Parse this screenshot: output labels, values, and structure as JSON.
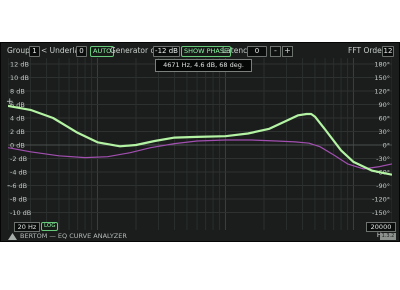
{
  "toolbar": {
    "group_label": "Group",
    "group_value": "1",
    "underlay_label": "< Underlay",
    "underlay_value": "0",
    "auto_label": "AUTO",
    "generator_label": "Generator out",
    "generator_value": "-12 dB",
    "show_phase_label": "SHOW PHASE",
    "latency_label": "Latency",
    "latency_value": "0",
    "minus_label": "-",
    "plus_label": "+",
    "fft_label": "FFT Order",
    "fft_value": "12"
  },
  "tooltip": "4671 Hz, 4.6 dB, 68 deg.",
  "side_markers": {
    "plus": "+",
    "minus": "-"
  },
  "freq": {
    "min": "20 Hz",
    "log_label": "LOG",
    "max": "20000 Hz"
  },
  "footer": {
    "title": "BERTOM — EQ CURVE ANALYZER",
    "version": "1.3.2"
  },
  "colors": {
    "eq_curve": "#b3f3a3",
    "phase_curve": "#a24fb1",
    "background": "#1a1d1c",
    "accent": "#67c97a"
  },
  "chart_data": {
    "type": "line",
    "x_scale": "log",
    "xlim": [
      20,
      20000
    ],
    "y_left_ticks": [
      "12 dB",
      "10 dB",
      "8 dB",
      "6 dB",
      "4 dB",
      "2 dB",
      "0 dB",
      "-2 dB",
      "-4 dB",
      "-6 dB",
      "-8 dB",
      "-10 dB"
    ],
    "y_right_ticks": [
      "180°",
      "150°",
      "120°",
      "90°",
      "60°",
      "30°",
      "0°",
      "-30°",
      "-60°",
      "-90°",
      "-120°",
      "-150°"
    ],
    "ylim_db": [
      -12,
      12
    ],
    "ylim_deg": [
      -180,
      180
    ],
    "series": [
      {
        "color": "#b3f3a3",
        "unit": "dB",
        "x": [
          20,
          30,
          45,
          70,
          100,
          150,
          200,
          280,
          400,
          600,
          1000,
          1500,
          2200,
          3000,
          3700,
          4300,
          4671,
          5000,
          6000,
          8000,
          10000,
          14000,
          20000
        ],
        "y": [
          5.8,
          5.2,
          4.0,
          1.8,
          0.4,
          -0.2,
          0.0,
          0.6,
          1.1,
          1.2,
          1.3,
          1.7,
          2.4,
          3.6,
          4.4,
          4.6,
          4.6,
          4.2,
          2.3,
          -0.8,
          -2.5,
          -3.8,
          -4.4
        ]
      },
      {
        "color": "#a24fb1",
        "unit": "deg",
        "x": [
          20,
          30,
          50,
          80,
          120,
          180,
          260,
          400,
          600,
          1000,
          1600,
          2500,
          3500,
          4500,
          5500,
          7000,
          9000,
          12000,
          16000,
          20000
        ],
        "y": [
          -6,
          -15,
          -24,
          -28,
          -26,
          -17,
          -6,
          3,
          9,
          11,
          11,
          9,
          7,
          4,
          -4,
          -22,
          -42,
          -53,
          -48,
          -42
        ]
      }
    ]
  }
}
